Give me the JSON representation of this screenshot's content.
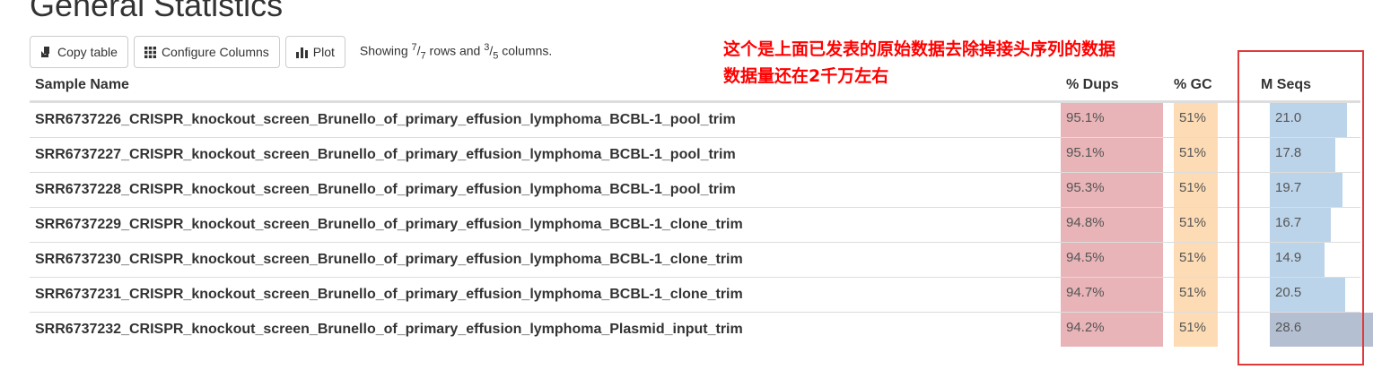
{
  "page": {
    "title": "General Statistics"
  },
  "toolbar": {
    "copy_label": "Copy table",
    "configure_label": "Configure Columns",
    "plot_label": "Plot",
    "showing": {
      "prefix": "Showing ",
      "rows_shown": "7",
      "rows_total": "7",
      "mid": " rows and ",
      "cols_shown": "3",
      "cols_total": "5",
      "suffix": " columns."
    }
  },
  "annotation": {
    "line1": "这个是上面已发表的原始数据去除掉接头序列的数据",
    "line2": "数据量还在2千万左右",
    "color": "#ff0000"
  },
  "table": {
    "headers": {
      "name": "Sample Name",
      "dups": "% Dups",
      "gc": "% GC",
      "mseqs": "M Seqs"
    },
    "colors": {
      "dups": "#e8b4b8",
      "gc": "#fddcb5",
      "mseqs": "#bcd4ea",
      "mseqs_max": "#b4c0d2"
    },
    "rows": [
      {
        "name": "SRR6737226_CRISPR_knockout_screen_Brunello_of_primary_effusion_lymphoma_BCBL-1_pool_trim",
        "dups": "95.1%",
        "dups_pct": 95.1,
        "gc": "51%",
        "gc_pct": 51,
        "mseqs": "21.0",
        "mseqs_val": 21.0
      },
      {
        "name": "SRR6737227_CRISPR_knockout_screen_Brunello_of_primary_effusion_lymphoma_BCBL-1_pool_trim",
        "dups": "95.1%",
        "dups_pct": 95.1,
        "gc": "51%",
        "gc_pct": 51,
        "mseqs": "17.8",
        "mseqs_val": 17.8
      },
      {
        "name": "SRR6737228_CRISPR_knockout_screen_Brunello_of_primary_effusion_lymphoma_BCBL-1_pool_trim",
        "dups": "95.3%",
        "dups_pct": 95.3,
        "gc": "51%",
        "gc_pct": 51,
        "mseqs": "19.7",
        "mseqs_val": 19.7
      },
      {
        "name": "SRR6737229_CRISPR_knockout_screen_Brunello_of_primary_effusion_lymphoma_BCBL-1_clone_trim",
        "dups": "94.8%",
        "dups_pct": 94.8,
        "gc": "51%",
        "gc_pct": 51,
        "mseqs": "16.7",
        "mseqs_val": 16.7
      },
      {
        "name": "SRR6737230_CRISPR_knockout_screen_Brunello_of_primary_effusion_lymphoma_BCBL-1_clone_trim",
        "dups": "94.5%",
        "dups_pct": 94.5,
        "gc": "51%",
        "gc_pct": 51,
        "mseqs": "14.9",
        "mseqs_val": 14.9
      },
      {
        "name": "SRR6737231_CRISPR_knockout_screen_Brunello_of_primary_effusion_lymphoma_BCBL-1_clone_trim",
        "dups": "94.7%",
        "dups_pct": 94.7,
        "gc": "51%",
        "gc_pct": 51,
        "mseqs": "20.5",
        "mseqs_val": 20.5
      },
      {
        "name": "SRR6737232_CRISPR_knockout_screen_Brunello_of_primary_effusion_lymphoma_Plasmid_input_trim",
        "dups": "94.2%",
        "dups_pct": 94.2,
        "gc": "51%",
        "gc_pct": 51,
        "mseqs": "28.6",
        "mseqs_val": 28.6
      }
    ]
  }
}
